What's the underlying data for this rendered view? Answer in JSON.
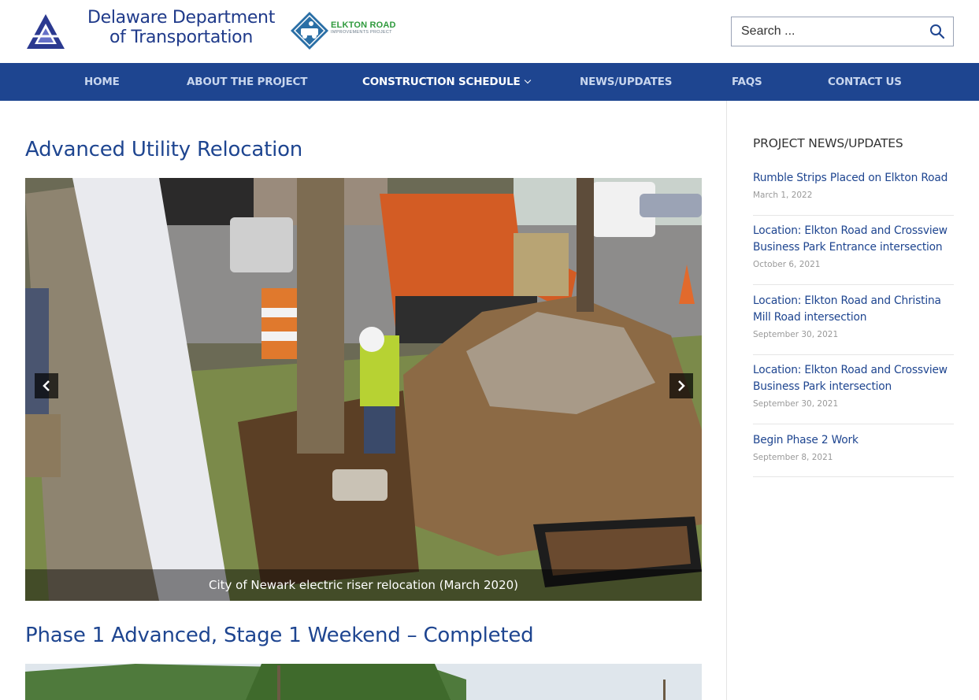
{
  "header": {
    "org_line1": "Delaware Department",
    "org_line2": "of Transportation",
    "project_title": "ELKTON ROAD",
    "project_sub": "IMPROVEMENTS PROJECT"
  },
  "search": {
    "placeholder": "Search ..."
  },
  "nav": {
    "items": [
      {
        "label": "HOME"
      },
      {
        "label": "ABOUT THE PROJECT"
      },
      {
        "label": "CONSTRUCTION SCHEDULE"
      },
      {
        "label": "NEWS/UPDATES"
      },
      {
        "label": "FAQS"
      },
      {
        "label": "CONTACT US"
      }
    ]
  },
  "main": {
    "section1_title": "Advanced Utility Relocation",
    "slide_caption": "City of Newark electric riser relocation (March 2020)",
    "section2_title": "Phase 1 Advanced, Stage 1 Weekend – Completed"
  },
  "sidebar": {
    "title": "PROJECT NEWS/UPDATES",
    "items": [
      {
        "title": "Rumble Strips Placed on Elkton Road",
        "date": "March 1, 2022"
      },
      {
        "title": "Location: Elkton Road and Crossview Business Park Entrance intersection",
        "date": "October 6, 2021"
      },
      {
        "title": "Location: Elkton Road and Christina Mill Road intersection",
        "date": "September 30, 2021"
      },
      {
        "title": "Location: Elkton Road and Crossview Business Park intersection",
        "date": "September 30, 2021"
      },
      {
        "title": "Begin Phase 2 Work",
        "date": "September 8, 2021"
      }
    ]
  },
  "colors": {
    "brand_blue": "#1e4590",
    "logo_green": "#2e9a3c"
  },
  "icons": [
    "deldot-logo-icon",
    "elkton-project-logo-icon",
    "search-icon",
    "chevron-down-icon",
    "chevron-left-icon",
    "chevron-right-icon"
  ]
}
